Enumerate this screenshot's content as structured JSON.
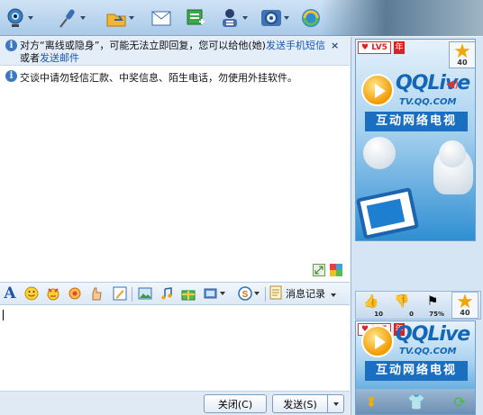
{
  "toolbar": {
    "buttons": [
      {
        "name": "video-icon"
      },
      {
        "name": "voice-icon"
      },
      {
        "name": "send-file-icon"
      },
      {
        "name": "mail-icon"
      },
      {
        "name": "create-group-icon"
      },
      {
        "name": "user-info-icon"
      },
      {
        "name": "settings-icon"
      },
      {
        "name": "apps-icon"
      }
    ]
  },
  "notice": {
    "text_prefix": "对方“离线或隐身”，可能无法立即回复，您可以给他(她)",
    "link_sms": "发送手机短信",
    "or": "或者",
    "link_mail": "发送邮件",
    "close": "×"
  },
  "chat": {
    "warning": "交谈中请勿轻信汇款、中奖信息、陌生电话，勿使用外挂软件。"
  },
  "format_bar": {
    "font_icon": "A",
    "history_label": "消息记录"
  },
  "buttons": {
    "close_label": "关闭(C)",
    "send_label": "发送(S)"
  },
  "ads": {
    "lv_badge": "LV5",
    "nian": "年",
    "star_value": "40",
    "title": "QQLive",
    "url": "TV.QQ.COM",
    "subtitle": "互动网络电视",
    "vol_badge": "1"
  },
  "mid_bar": {
    "thumb_up_count": "10",
    "thumb_down_count": "0",
    "percent": "75%",
    "star_value": "40"
  },
  "colors": {
    "accent": "#1466b8",
    "toolbar": "#a9c9e8",
    "link": "#1a56b0"
  }
}
